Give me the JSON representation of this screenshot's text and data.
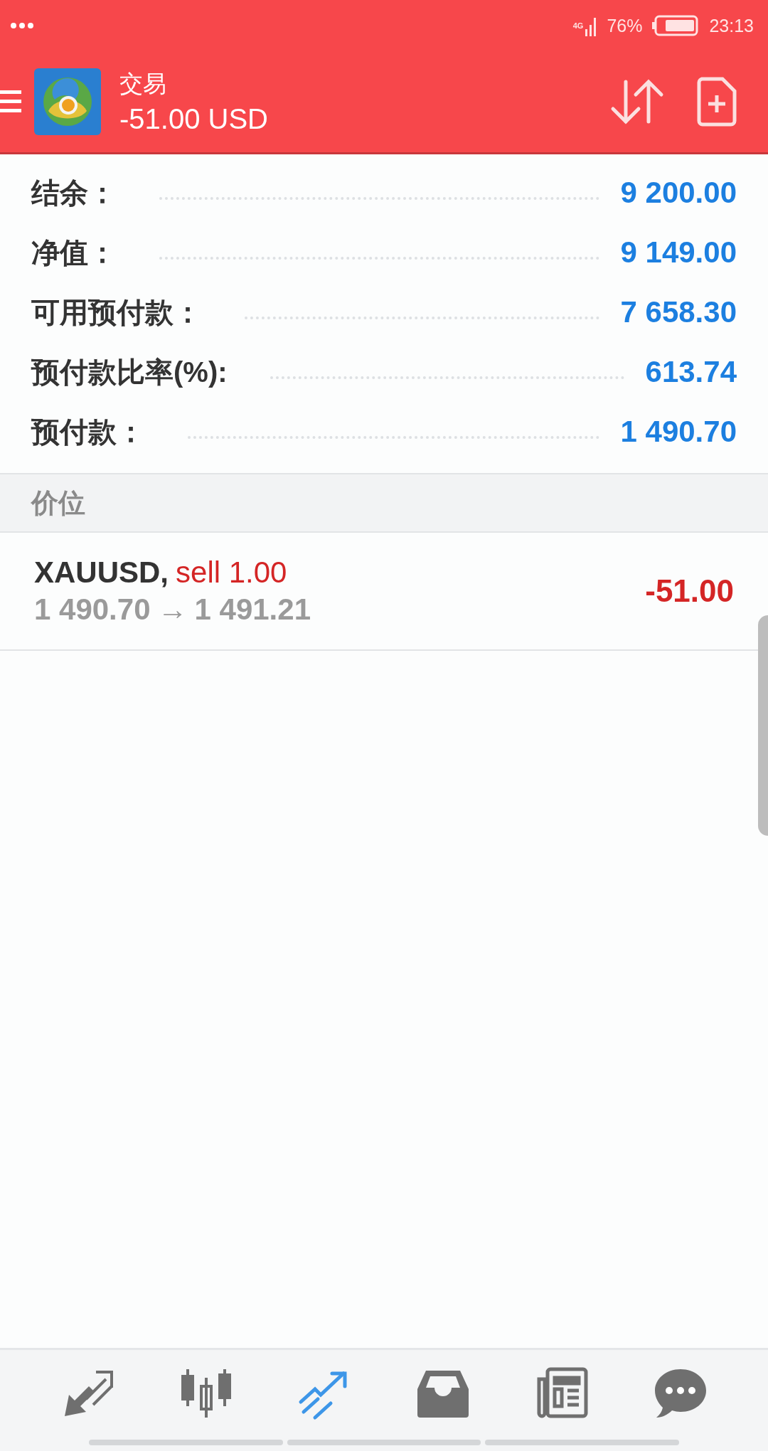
{
  "status_bar": {
    "network": "4G",
    "battery": "76%",
    "time": "23:13"
  },
  "header": {
    "title": "交易",
    "subtitle": "-51.00 USD"
  },
  "summary": [
    {
      "label": "结余：",
      "value": "9 200.00"
    },
    {
      "label": "净值：",
      "value": "9 149.00"
    },
    {
      "label": "可用预付款：",
      "value": "7 658.30"
    },
    {
      "label": "预付款比率(%):",
      "value": "613.74"
    },
    {
      "label": "预付款：",
      "value": "1 490.70"
    }
  ],
  "section": {
    "title": "价位"
  },
  "positions": [
    {
      "symbol": "XAUUSD,",
      "order": "sell 1.00",
      "open_price": "1 490.70",
      "arrow": "→",
      "current_price": "1 491.21",
      "profit": "-51.00"
    }
  ],
  "bottom_nav": [
    {
      "kind": "quotes",
      "selected": false
    },
    {
      "kind": "chart",
      "selected": false
    },
    {
      "kind": "trade",
      "selected": true
    },
    {
      "kind": "history",
      "selected": false
    },
    {
      "kind": "news",
      "selected": false
    },
    {
      "kind": "chat",
      "selected": false
    }
  ]
}
